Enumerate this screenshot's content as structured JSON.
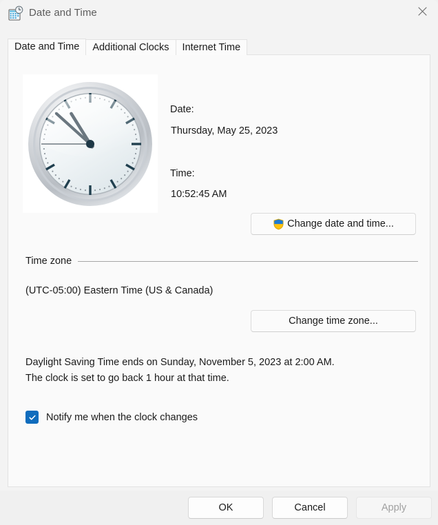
{
  "window": {
    "title": "Date and Time",
    "icon": "date-time-calendar-clock-icon",
    "close_label": "✕"
  },
  "tabs": [
    {
      "label": "Date and Time",
      "selected": true
    },
    {
      "label": "Additional Clocks",
      "selected": false
    },
    {
      "label": "Internet Time",
      "selected": false
    }
  ],
  "date_time_panel": {
    "clock": {
      "name": "analog-clock-image",
      "hour_angle": 328,
      "minute_angle": 312,
      "second_angle": 270
    },
    "date_label": "Date:",
    "date_value": "Thursday, May 25, 2023",
    "time_label": "Time:",
    "time_value": "10:52:45 AM",
    "change_date_time_button": "Change date and time..."
  },
  "time_zone": {
    "group_title": "Time zone",
    "value": "(UTC-05:00) Eastern Time (US & Canada)",
    "change_button": "Change time zone..."
  },
  "daylight_saving": {
    "line1": "Daylight Saving Time ends on Sunday, November 5, 2023 at 2:00 AM.",
    "line2": "The clock is set to go back 1 hour at that time."
  },
  "notify_checkbox": {
    "label": "Notify me when the clock changes",
    "checked": true
  },
  "footer": {
    "ok": "OK",
    "cancel": "Cancel",
    "apply": "Apply",
    "apply_enabled": false
  },
  "colors": {
    "accent": "#0f6cbd",
    "shield_blue": "#1b7ad6",
    "shield_yellow": "#ffc20e",
    "window_bg": "#f3f3f3",
    "page_bg": "#fafafa",
    "footer_bg": "#f0f0f0"
  }
}
